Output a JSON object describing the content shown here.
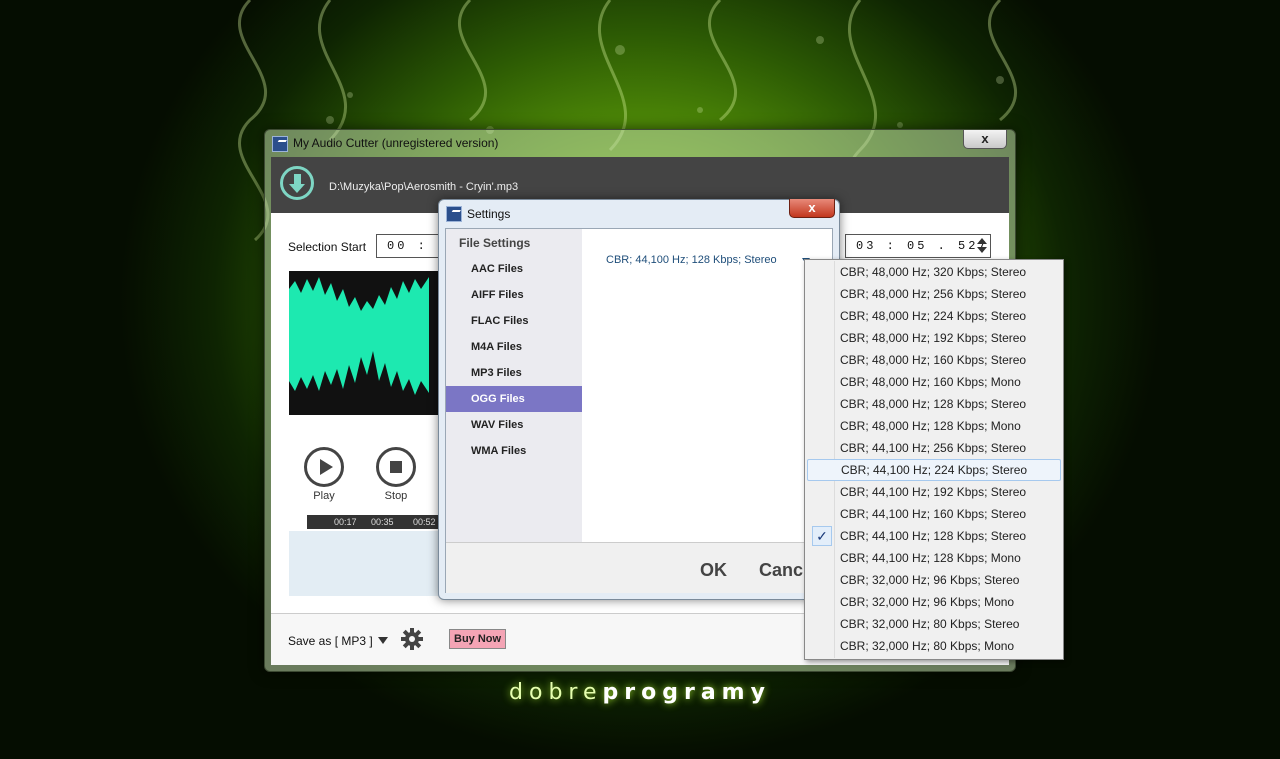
{
  "main_window": {
    "title": "My Audio Cutter (unregistered version)",
    "close_label": "x",
    "file_path": "D:\\Muzyka\\Pop\\Aerosmith - Cryin'.mp3",
    "selection_start_label": "Selection Start",
    "selection_start_value": "00 : 0",
    "selection_end_value": "03 : 05 . 527",
    "timeline_ticks": [
      "00:17",
      "00:35",
      "00:52"
    ],
    "play_label": "Play",
    "stop_label": "Stop",
    "save_as_label": "Save as [ MP3 ]",
    "buy_now_label": "Buy Now",
    "waveform_color": "#1de9b0",
    "selection_color": "#c2275c"
  },
  "settings": {
    "title": "Settings",
    "close_label": "x",
    "section_header": "File Settings",
    "categories": [
      "AAC Files",
      "AIFF Files",
      "FLAC Files",
      "M4A Files",
      "MP3 Files",
      "OGG Files",
      "WAV Files",
      "WMA Files"
    ],
    "selected_category": "OGG Files",
    "format_value": "CBR; 44,100 Hz; 128 Kbps; Stereo",
    "ok_label": "OK",
    "cancel_label": "Canc",
    "selected_color": "#7b76c5"
  },
  "dropdown": {
    "items": [
      "CBR; 48,000 Hz; 320 Kbps; Stereo",
      "CBR; 48,000 Hz; 256 Kbps; Stereo",
      "CBR; 48,000 Hz; 224 Kbps; Stereo",
      "CBR; 48,000 Hz; 192 Kbps; Stereo",
      "CBR; 48,000 Hz; 160 Kbps; Stereo",
      "CBR; 48,000 Hz; 160 Kbps; Mono",
      "CBR; 48,000 Hz; 128 Kbps; Stereo",
      "CBR; 48,000 Hz; 128 Kbps; Mono",
      "CBR; 44,100 Hz; 256 Kbps; Stereo",
      "CBR; 44,100 Hz; 224 Kbps; Stereo",
      "CBR; 44,100 Hz; 192 Kbps; Stereo",
      "CBR; 44,100 Hz; 160 Kbps; Stereo",
      "CBR; 44,100 Hz; 128 Kbps; Stereo",
      "CBR; 44,100 Hz; 128 Kbps; Mono",
      "CBR; 32,000 Hz; 96 Kbps; Stereo",
      "CBR; 32,000 Hz; 96 Kbps; Mono",
      "CBR; 32,000 Hz; 80 Kbps; Stereo",
      "CBR; 32,000 Hz; 80 Kbps; Mono"
    ],
    "hovered_item": "CBR; 44,100 Hz; 224 Kbps; Stereo",
    "checked_item": "CBR; 44,100 Hz; 128 Kbps; Stereo",
    "check_glyph": "✓"
  },
  "branding": {
    "part1": "dobre",
    "part2": "programy"
  }
}
